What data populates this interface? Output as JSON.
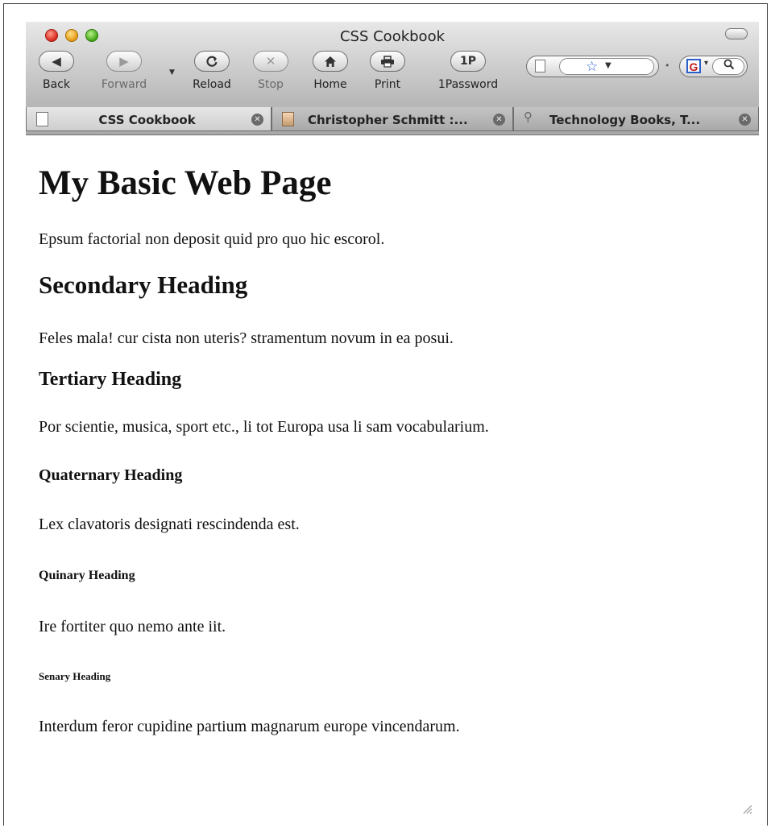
{
  "window": {
    "title": "CSS Cookbook"
  },
  "toolbar": {
    "back_label": "Back",
    "forward_label": "Forward",
    "reload_label": "Reload",
    "stop_label": "Stop",
    "home_label": "Home",
    "print_label": "Print",
    "onepassword_label": "1Password",
    "onepassword_glyph": "1P",
    "search_engine_glyph": "G"
  },
  "tabs": [
    {
      "label": "CSS Cookbook",
      "active": true
    },
    {
      "label": "Christopher Schmitt :...",
      "active": false
    },
    {
      "label": "Technology Books, T...",
      "active": false
    }
  ],
  "page": {
    "h1": "My Basic Web Page",
    "p1": "Epsum factorial non deposit quid pro quo hic escorol.",
    "h2": "Secondary Heading",
    "p2": "Feles mala! cur cista non uteris? stramentum novum in ea posui.",
    "h3": "Tertiary Heading",
    "p3": "Por scientie, musica, sport etc., li tot Europa usa li sam vocabularium.",
    "h4": "Quaternary Heading",
    "p4": "Lex clavatoris designati rescindenda est.",
    "h5": "Quinary Heading",
    "p5": "Ire fortiter quo nemo ante iit.",
    "h6": "Senary Heading",
    "p6": "Interdum feror cupidine partium magnarum europe vincendarum."
  },
  "colors": {
    "close_light": "#d8291c",
    "minimize_light": "#e39a12",
    "zoom_light": "#3fa515",
    "star": "#2a5fc9"
  },
  "icons": {
    "back": "back-arrow-icon",
    "forward": "forward-arrow-icon",
    "reload": "reload-icon",
    "stop": "stop-icon",
    "home": "home-icon",
    "print": "printer-icon",
    "bookmark": "star-icon",
    "search": "magnifier-icon"
  }
}
